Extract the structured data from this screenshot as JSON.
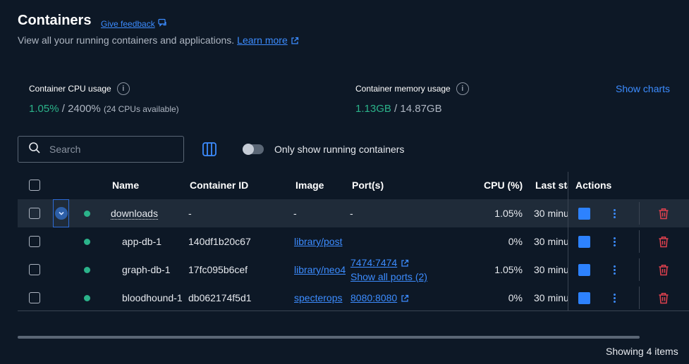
{
  "header": {
    "title": "Containers",
    "feedback_label": "Give feedback",
    "subtitle": "View all your running containers and applications.",
    "learn_more": "Learn more"
  },
  "stats": {
    "cpu": {
      "label": "Container CPU usage",
      "used": "1.05%",
      "separator": " / ",
      "total": "2400%",
      "note": "(24 CPUs available)"
    },
    "memory": {
      "label": "Container memory usage",
      "used": "1.13GB",
      "separator": " / ",
      "total": "14.87GB"
    },
    "show_charts": "Show charts"
  },
  "search": {
    "placeholder": "Search",
    "value": ""
  },
  "filter": {
    "label": "Only show running containers",
    "enabled": false
  },
  "table": {
    "headers": {
      "name": "Name",
      "container_id": "Container ID",
      "image": "Image",
      "ports": "Port(s)",
      "cpu": "CPU (%)",
      "last_started": "Last sta",
      "actions": "Actions"
    },
    "rows": [
      {
        "name": "downloads",
        "container_id": "-",
        "image": "-",
        "port": "-",
        "port_extra": "",
        "cpu": "1.05%",
        "last_started": "30 minu"
      },
      {
        "name": "app-db-1",
        "container_id": "140df1b20c67",
        "image": "library/post",
        "port": "",
        "port_extra": "",
        "cpu": "0%",
        "last_started": "30 minu"
      },
      {
        "name": "graph-db-1",
        "container_id": "17fc095b6cef",
        "image": "library/neo4",
        "port": "7474:7474",
        "port_extra": "Show all ports (2)",
        "cpu": "1.05%",
        "last_started": "30 minu"
      },
      {
        "name": "bloodhound-1",
        "container_id": "db062174f5d1",
        "image": "specterops",
        "port": "8080:8080",
        "port_extra": "",
        "cpu": "0%",
        "last_started": "30 minu"
      }
    ]
  },
  "footer": {
    "showing": "Showing 4 items"
  },
  "colors": {
    "accent": "#3c8cff",
    "running": "#2bb38a",
    "danger": "#e0414e",
    "background": "#0d1826"
  }
}
